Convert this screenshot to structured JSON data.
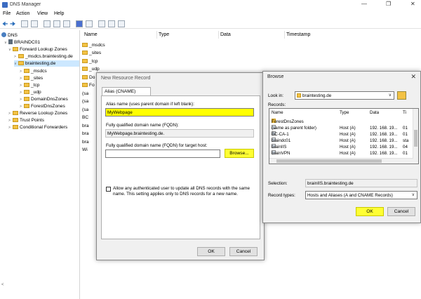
{
  "window": {
    "title": "DNS Manager"
  },
  "menu": [
    "File",
    "Action",
    "View",
    "Help"
  ],
  "tree": [
    {
      "label": "DNS",
      "level": 0,
      "icon": "dns"
    },
    {
      "label": "BRAINDC01",
      "level": 1,
      "icon": "server"
    },
    {
      "label": "Forward Lookup Zones",
      "level": 2,
      "icon": "folder"
    },
    {
      "label": "_msdcs.braintesting.de",
      "level": 3,
      "icon": "zone"
    },
    {
      "label": "braintesting.de",
      "level": 3,
      "icon": "zone",
      "selected": true
    },
    {
      "label": "_msdcs",
      "level": 4,
      "icon": "folder"
    },
    {
      "label": "_sites",
      "level": 4,
      "icon": "folder"
    },
    {
      "label": "_tcp",
      "level": 4,
      "icon": "folder"
    },
    {
      "label": "_udp",
      "level": 4,
      "icon": "folder"
    },
    {
      "label": "DomainDnsZones",
      "level": 4,
      "icon": "folder"
    },
    {
      "label": "ForestDnsZones",
      "level": 4,
      "icon": "folder"
    },
    {
      "label": "Reverse Lookup Zones",
      "level": 2,
      "icon": "folder"
    },
    {
      "label": "Trust Points",
      "level": 2,
      "icon": "folder"
    },
    {
      "label": "Conditional Forwarders",
      "level": 2,
      "icon": "folder"
    }
  ],
  "list": {
    "columns": [
      "Name",
      "Type",
      "Data",
      "Timestamp"
    ],
    "rows": [
      "_msdcs",
      "_sites",
      "_tcp",
      "_udp",
      "Do",
      "Fo",
      "(sa",
      "(sa",
      "(sa",
      "BC",
      "bra",
      "bra",
      "bra",
      "Wi"
    ]
  },
  "new_record": {
    "title": "New Resource Record",
    "tab": "Alias (CNAME)",
    "alias_label": "Alias name (uses parent domain if left blank):",
    "alias_value": "MyWebpage",
    "fqdn_label": "Fully qualified domain name (FQDN):",
    "fqdn_value": "MyWebpage.braintesting.de.",
    "target_label": "Fully qualified domain name (FQDN) for target host:",
    "target_value": "",
    "browse": "Browse...",
    "checkbox_text_1": "Allow any authenticated user to update all DNS records with the same",
    "checkbox_text_2": "name. This setting applies only to DNS records for a new name.",
    "ok": "OK",
    "cancel": "Cancel"
  },
  "browse": {
    "title": "Browse",
    "look_in_label": "Look in:",
    "look_in_value": "braintesting.de",
    "records_label": "Records:",
    "headers": [
      "Name",
      "Type",
      "Data",
      "Ti"
    ],
    "rows": [
      {
        "name": "ForestDnsZones",
        "type": "",
        "data": "",
        "ts": "",
        "folder": true
      },
      {
        "name": "(same as parent folder)",
        "type": "Host (A)",
        "data": "192. 168. 19...",
        "ts": "01"
      },
      {
        "name": "BC-CA-1",
        "type": "Host (A)",
        "data": "192. 168. 19...",
        "ts": "01"
      },
      {
        "name": "braindc01",
        "type": "Host (A)",
        "data": "192. 168. 19...",
        "ts": "sta"
      },
      {
        "name": "brainIIS",
        "type": "Host (A)",
        "data": "192. 168. 19...",
        "ts": "04",
        "selected": true
      },
      {
        "name": "brainVPN",
        "type": "Host (A)",
        "data": "192. 168. 19...",
        "ts": "01"
      }
    ],
    "selection_label": "Selection:",
    "selection_value": "brainIIS.braintesting.de",
    "record_types_label": "Record types:",
    "record_types_value": "Hosts and Aliases (A and CNAME Records)",
    "ok": "OK",
    "cancel": "Cancel"
  }
}
